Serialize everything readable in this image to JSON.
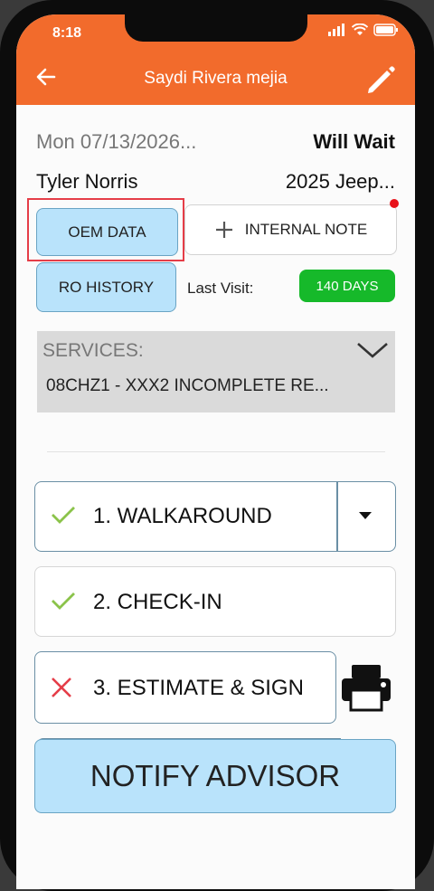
{
  "status_bar": {
    "time": "8:18"
  },
  "header": {
    "title": "Saydi Rivera mejia"
  },
  "appointment": {
    "date": "Mon 07/13/2026...",
    "wait_status": "Will Wait",
    "customer_name": "Tyler Norris",
    "vehicle": "2025 Jeep..."
  },
  "buttons": {
    "oem_data": "OEM DATA",
    "internal_note": "INTERNAL NOTE",
    "ro_history": "RO HISTORY"
  },
  "last_visit": {
    "label": "Last Visit:",
    "value": "140 DAYS"
  },
  "services": {
    "label": "SERVICES:",
    "value": "08CHZ1 - XXX2 INCOMPLETE RE..."
  },
  "steps": [
    {
      "label": "1. WALKAROUND",
      "status": "complete"
    },
    {
      "label": "2. CHECK-IN",
      "status": "complete"
    },
    {
      "label": "3. ESTIMATE & SIGN",
      "status": "incomplete"
    }
  ],
  "notify_button": "NOTIFY ADVISOR",
  "colors": {
    "header": "#f26b2c",
    "check": "#8bc34a",
    "cross": "#e53d48",
    "badge": "#16b92a",
    "button_blue": "#b9e3fb"
  }
}
